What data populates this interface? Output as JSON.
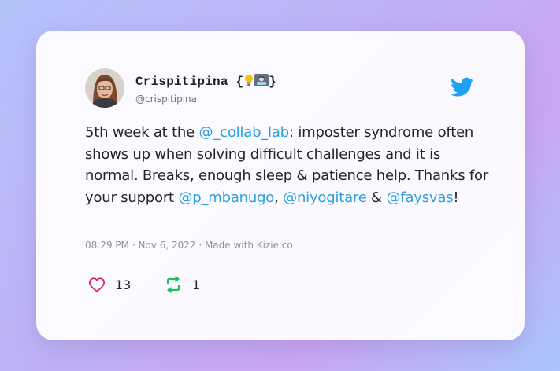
{
  "colors": {
    "accent": "#2ca0e0",
    "like": "#e0245e",
    "retweet": "#17bf63"
  },
  "author": {
    "name": "Crispitipina",
    "name_braces_open": "{",
    "name_braces_close": "}",
    "name_emoji": [
      "lightbulb-icon",
      "technologist-icon"
    ],
    "handle": "@crispitipina"
  },
  "tweet": {
    "segments": [
      {
        "text": "5th week at the ",
        "mention": false
      },
      {
        "text": "@_collab_lab",
        "mention": true
      },
      {
        "text": ": imposter syndrome often shows up when solving difficult challenges and it is normal. Breaks, enough sleep & patience help. Thanks for your support ",
        "mention": false
      },
      {
        "text": "@p_mbanugo",
        "mention": true
      },
      {
        "text": ", ",
        "mention": false
      },
      {
        "text": "@niyogitare",
        "mention": true
      },
      {
        "text": " & ",
        "mention": false
      },
      {
        "text": "@faysvas",
        "mention": true
      },
      {
        "text": "!",
        "mention": false
      }
    ]
  },
  "meta": {
    "time": "08:29 PM",
    "sep1": " · ",
    "date": "Nov 6, 2022",
    "sep2": " · ",
    "made_with": "Made with Kizie.co"
  },
  "stats": {
    "likes": "13",
    "retweets": "1"
  },
  "icons": {
    "brand": "twitter-bird-icon",
    "like": "heart-icon",
    "retweet": "retweet-icon"
  }
}
